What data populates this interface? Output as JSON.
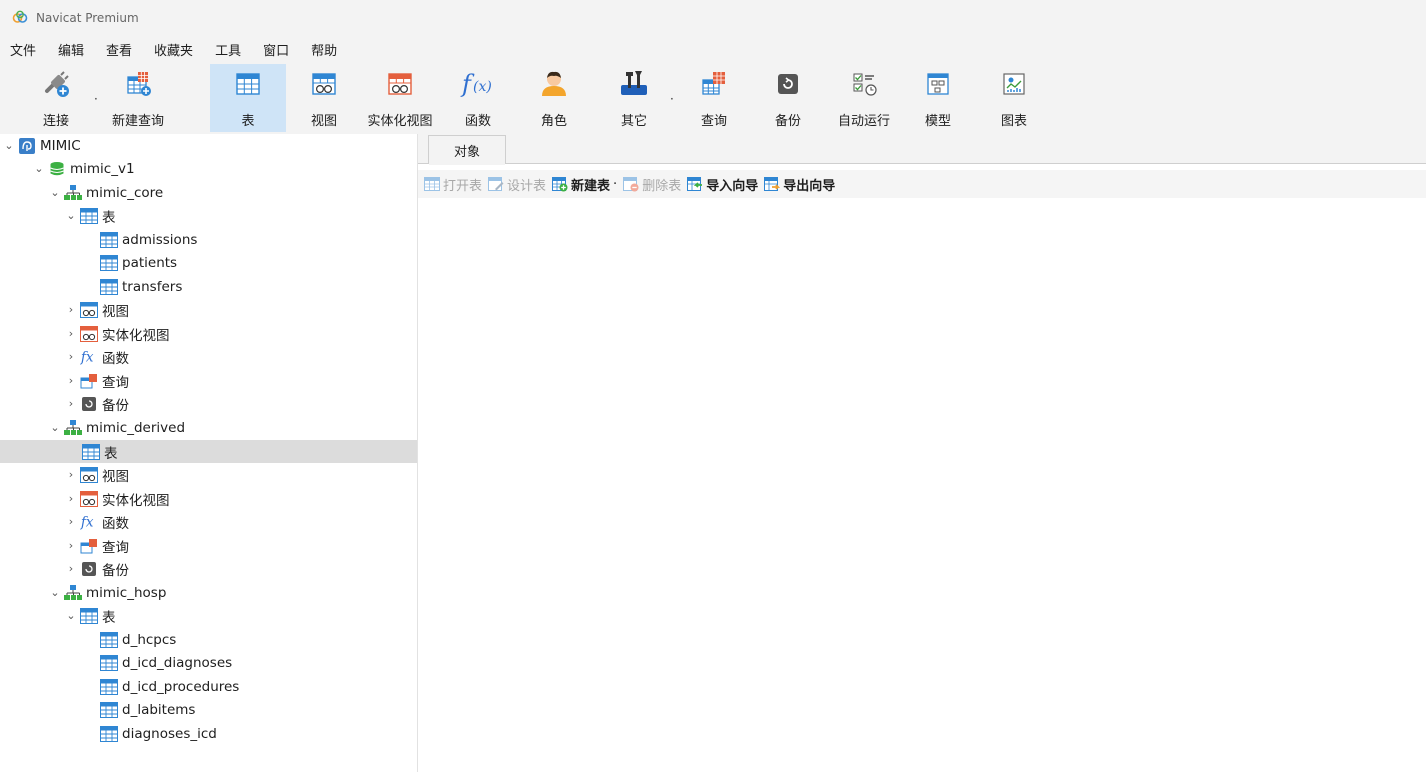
{
  "app": {
    "title": "Navicat Premium"
  },
  "menu": [
    "文件",
    "编辑",
    "查看",
    "收藏夹",
    "工具",
    "窗口",
    "帮助"
  ],
  "toolbar": {
    "connect": "连接",
    "new_query": "新建查询",
    "table": "表",
    "view": "视图",
    "materialized_view": "实体化视图",
    "function": "函数",
    "role": "角色",
    "other": "其它",
    "query": "查询",
    "backup": "备份",
    "automation": "自动运行",
    "model": "模型",
    "chart": "图表"
  },
  "tree": {
    "connection": "MIMIC",
    "database": "mimic_v1",
    "schemas": [
      {
        "name": "mimic_core",
        "tables_label": "表",
        "tables": [
          "admissions",
          "patients",
          "transfers"
        ],
        "views": "视图",
        "mviews": "实体化视图",
        "functions": "函数",
        "queries": "查询",
        "backups": "备份"
      },
      {
        "name": "mimic_derived",
        "tables_label": "表",
        "views": "视图",
        "mviews": "实体化视图",
        "functions": "函数",
        "queries": "查询",
        "backups": "备份"
      },
      {
        "name": "mimic_hosp",
        "tables_label": "表",
        "tables": [
          "d_hcpcs",
          "d_icd_diagnoses",
          "d_icd_procedures",
          "d_labitems",
          "diagnoses_icd"
        ]
      }
    ]
  },
  "main": {
    "tab": "对象",
    "actions": {
      "open_table": "打开表",
      "design_table": "设计表",
      "new_table": "新建表",
      "delete_table": "删除表",
      "import_wizard": "导入向导",
      "export_wizard": "导出向导"
    }
  },
  "colors": {
    "accent_blue": "#3a8fd6",
    "active_tool": "#cfe4f7",
    "selected_row": "#dcdcdc",
    "db_green": "#3cb043"
  }
}
